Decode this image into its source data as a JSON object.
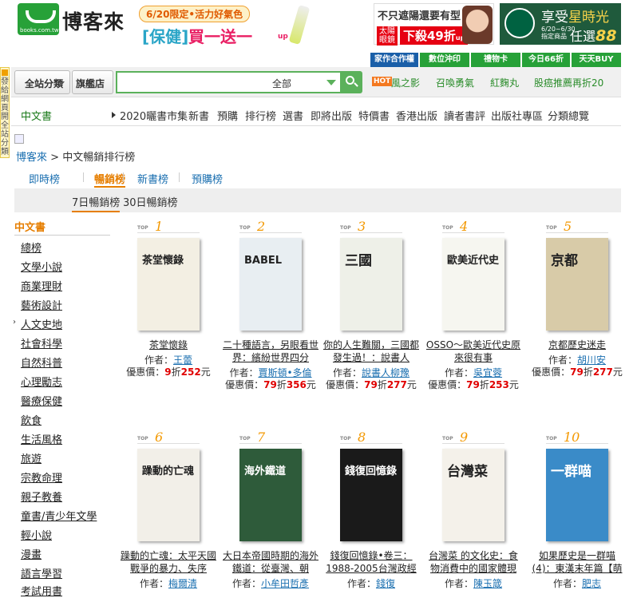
{
  "logo": {
    "name": "博客來",
    "url": "books.com.tw"
  },
  "promo": {
    "date_tag": "6/20限定•活力好氣色",
    "bracket": "[保健]",
    "offer": "買一送一",
    "suffix": "up"
  },
  "ad_sunglasses": {
    "line1": "不只遮陽還要有型",
    "badge": "太陽眼鏡",
    "discount": "下殺49折",
    "suffix": "up"
  },
  "ad_starbucks": {
    "line1": "享受",
    "line1_hl": "星時光",
    "date": "6/20~6/30",
    "note": "指定商品",
    "offer": "任選",
    "big": "88",
    "unit": "折"
  },
  "top_links": [
    "家作合作權",
    "數位沖印",
    "禮物卡",
    "今日66折",
    "天天BUY"
  ],
  "side_vertical": "發給網頁開全站分類",
  "search": {
    "category_btn": "全站分類",
    "store_btn": "旗艦店",
    "scope": "全部",
    "placeholder": ""
  },
  "hot": {
    "tag": "HOT",
    "words": [
      "風之影",
      "召喚勇氣",
      "紅麴丸",
      "股癌推薦再折20"
    ]
  },
  "catbar": {
    "current": "中文書",
    "items": [
      "2020曬書市集",
      "新書",
      "預購",
      "排行榜",
      "選書",
      "即將出版",
      "特價書",
      "香港出版",
      "讀者書評",
      "出版社專區",
      "分類總覽"
    ]
  },
  "breadcrumb": {
    "home": "博客來",
    "sep": " > ",
    "page": "中文暢銷排行榜"
  },
  "rank_tabs": [
    "即時榜",
    "暢銷榜",
    "新書榜",
    "預購榜"
  ],
  "period_tabs": [
    "7日暢銷榜",
    "30日暢銷榜"
  ],
  "leftnav": {
    "head": "中文書",
    "items": [
      "總榜",
      "文學小說",
      "商業理財",
      "藝術設計",
      "人文史地",
      "社會科學",
      "自然科普",
      "心理勵志",
      "醫療保健",
      "飲食",
      "生活風格",
      "旅遊",
      "宗教命理",
      "親子教養",
      "童書/青少年文學",
      "輕小說",
      "漫畫",
      "語言學習",
      "考試用書"
    ]
  },
  "labels": {
    "top": "TOP",
    "author": "作者：",
    "price": "優惠價：",
    "discount_unit": "折",
    "currency": "元"
  },
  "books": [
    {
      "rank": "1",
      "title": "茶堂懷錄",
      "author": "王蕾",
      "discount": "9",
      "price": "252",
      "cover_bg": "#f3efe3",
      "cover_text": "茶堂懷錄"
    },
    {
      "rank": "2",
      "title": "二十種語言，另眼看世界：繽紛世界四分",
      "author": "賈斯頓•多倫",
      "discount": "79",
      "price": "356",
      "cover_bg": "#e8eef2",
      "cover_text": "BABEL"
    },
    {
      "rank": "3",
      "title": "你的人生難關，三國都發生過！：說書人",
      "author": "說書人柳豫",
      "discount": "79",
      "price": "277",
      "cover_bg": "#eef0e8",
      "cover_text": "三國"
    },
    {
      "rank": "4",
      "title": "OSSO～歐美近代史原來很有事",
      "author": "吳宜蓉",
      "discount": "79",
      "price": "253",
      "cover_bg": "#f6f6f0",
      "cover_text": "歐美近代史"
    },
    {
      "rank": "5",
      "title": "京都歷史迷走",
      "author": "胡川安",
      "discount": "79",
      "price": "277",
      "cover_bg": "#d8cba8",
      "cover_text": "京都"
    },
    {
      "rank": "6",
      "title": "躁動的亡魂：太平天國戰爭的暴力、失序",
      "author": "梅爾清",
      "cover_bg": "#f2efe8",
      "cover_text": "躁動的亡魂"
    },
    {
      "rank": "7",
      "title": "大日本帝國時期的海外鐵道：從臺灣、朝",
      "author": "小牟田哲彥",
      "cover_bg": "#2e5b3a",
      "cover_text": "海外鐵道"
    },
    {
      "rank": "8",
      "title": "錢復回憶錄•卷三：1988-2005台灣政經",
      "author": "錢復",
      "cover_bg": "#1a1a1a",
      "cover_text": "錢復回憶錄"
    },
    {
      "rank": "9",
      "title": "台灣菜 的文化史：食物消費中的國家體現",
      "author": "陳玉箴",
      "cover_bg": "#f4f1ea",
      "cover_text": "台灣菜"
    },
    {
      "rank": "10",
      "title": "如果歷史是一群喵(4)：東漢末年篇【萌",
      "author": "肥志",
      "cover_bg": "#3a8bc8",
      "cover_text": "一群喵"
    }
  ],
  "colors": {
    "brand_green": "#27a138",
    "accent_orange": "#e67e00",
    "price_red": "#e00000",
    "link_blue": "#1a6fb0"
  }
}
